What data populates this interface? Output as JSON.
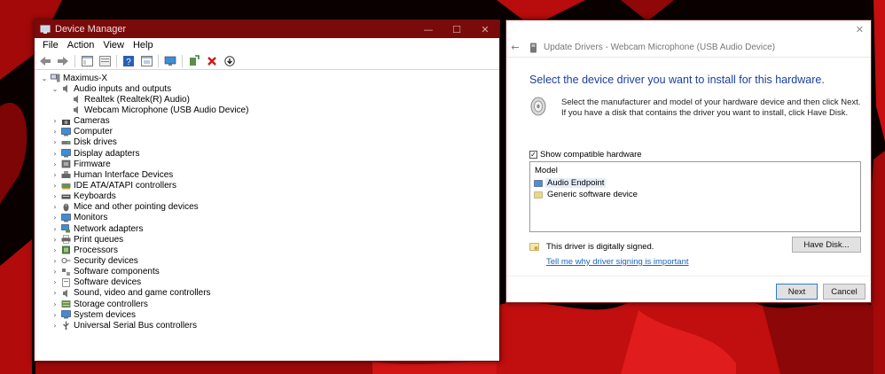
{
  "device_manager": {
    "title": "Device Manager",
    "controls": {
      "minimize": "—",
      "maximize": "☐",
      "close": "✕"
    },
    "menu": [
      "File",
      "Action",
      "View",
      "Help"
    ],
    "toolbar_icons": [
      "back-arrow-icon",
      "forward-arrow-icon",
      "properties-pane-icon",
      "show-hidden-icon",
      "help-icon",
      "view-icon",
      "monitor-scan-icon",
      "add-driver-icon",
      "uninstall-x-icon",
      "update-driver-icon"
    ],
    "tree": {
      "root": "Maximus-X",
      "audio": {
        "label": "Audio inputs and outputs",
        "children": [
          "Realtek (Realtek(R) Audio)",
          "Webcam Microphone (USB Audio Device)"
        ]
      },
      "categories": [
        "Cameras",
        "Computer",
        "Disk drives",
        "Display adapters",
        "Firmware",
        "Human Interface Devices",
        "IDE ATA/ATAPI controllers",
        "Keyboards",
        "Mice and other pointing devices",
        "Monitors",
        "Network adapters",
        "Print queues",
        "Processors",
        "Security devices",
        "Software components",
        "Software devices",
        "Sound, video and game controllers",
        "Storage controllers",
        "System devices",
        "Universal Serial Bus controllers"
      ]
    }
  },
  "update_drivers": {
    "close": "✕",
    "back": "←",
    "title": "Update Drivers - Webcam Microphone (USB Audio Device)",
    "heading": "Select the device driver you want to install for this hardware.",
    "description": "Select the manufacturer and model of your hardware device and then click Next. If you have a disk that contains the driver you want to install, click Have Disk.",
    "show_compatible": {
      "label": "Show compatible hardware",
      "checked": "✓"
    },
    "model_header": "Model",
    "models": [
      "Audio Endpoint",
      "Generic software device"
    ],
    "signed_text": "This driver is digitally signed.",
    "link": "Tell me why driver signing is important",
    "have_disk": "Have Disk...",
    "next": "Next",
    "cancel": "Cancel"
  },
  "colors": {
    "titlebar": "#7a0b0b",
    "heading_blue": "#1a3f9a",
    "link_blue": "#1a64c4",
    "wallpaper_red": "#c20d0d"
  }
}
